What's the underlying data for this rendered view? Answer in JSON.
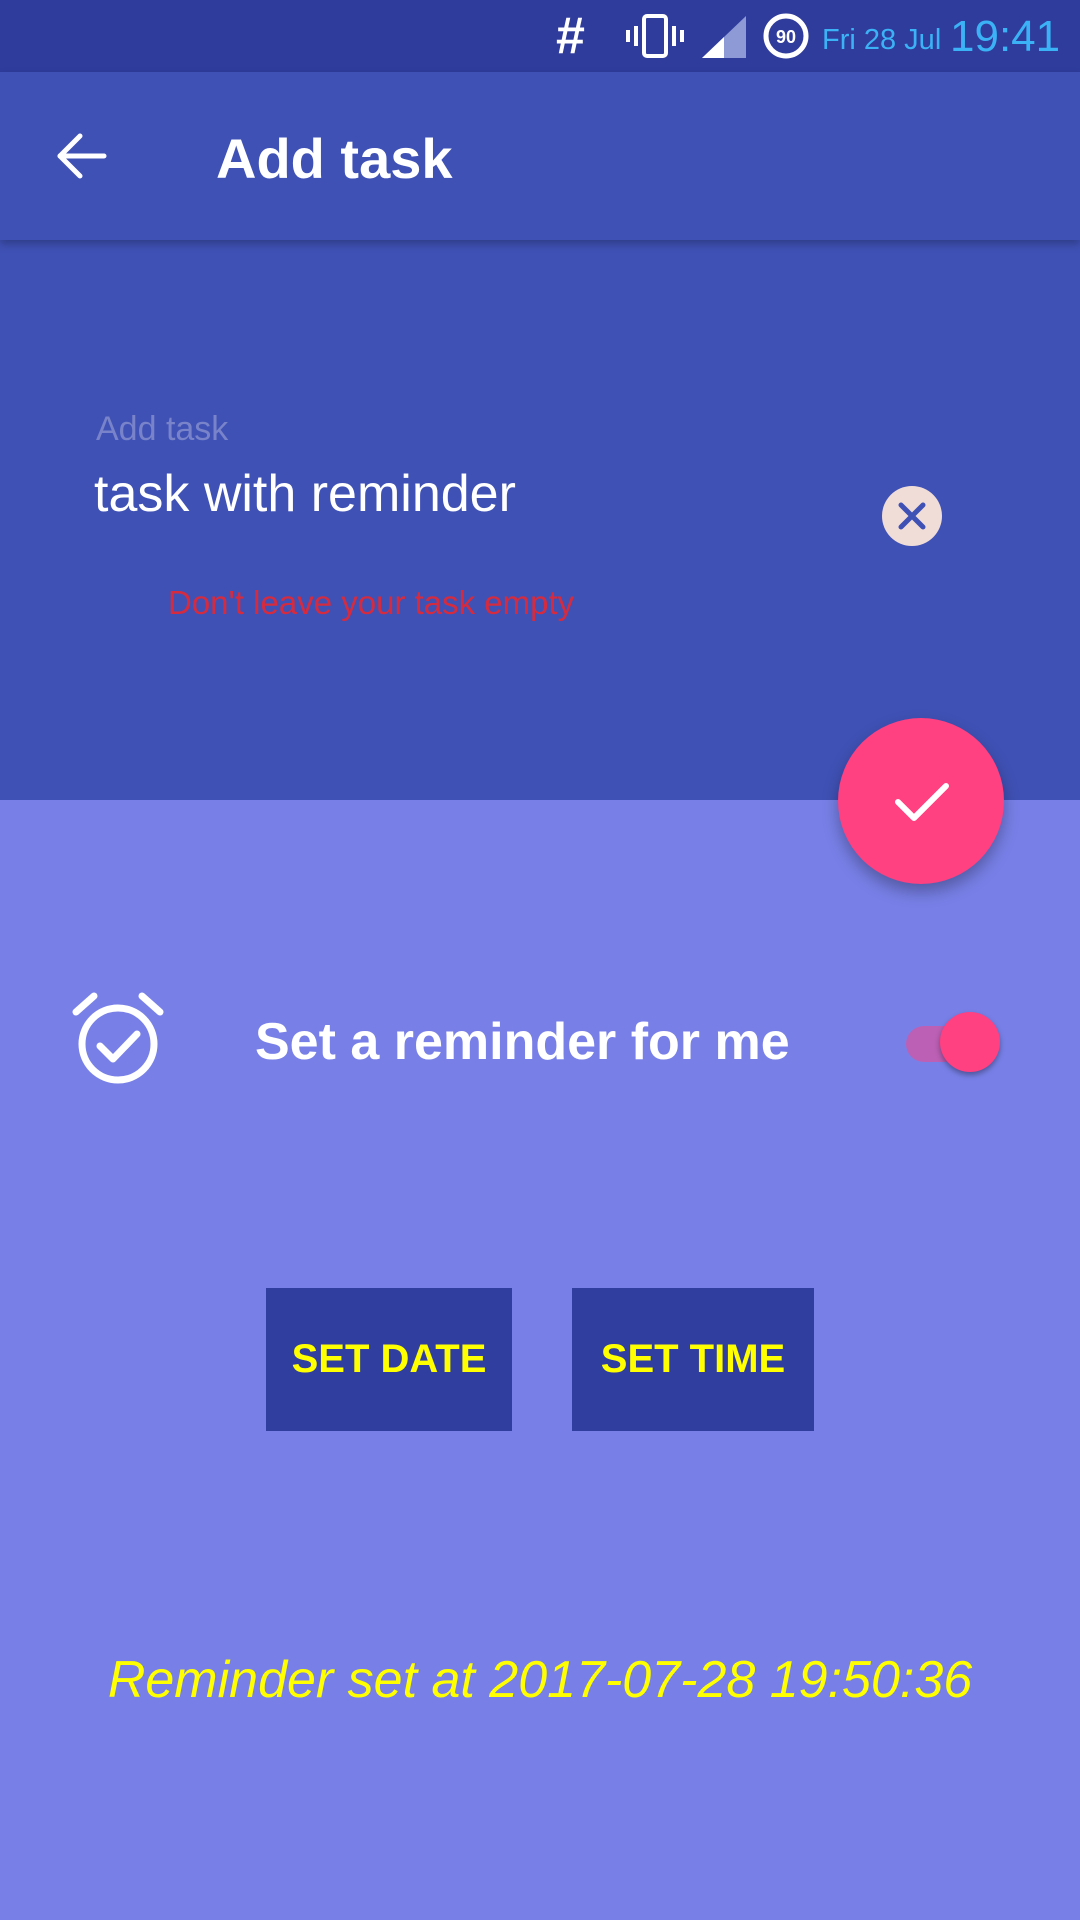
{
  "status_bar": {
    "carrier_symbol": "#",
    "battery_level": "90",
    "date": "Fri 28 Jul",
    "time": "19:41",
    "accent_color": "#3BB2F5"
  },
  "app_bar": {
    "title": "Add task",
    "back_icon": "arrow-back-icon",
    "color": "#3F51B5"
  },
  "task_form": {
    "field_label": "Add task",
    "input_value": "task with reminder",
    "clear_icon": "close-circle-icon",
    "error_text": "Don't leave your task empty",
    "error_color": "#D62B3E"
  },
  "fab": {
    "icon": "check-icon",
    "color": "#FF4081"
  },
  "reminder": {
    "icon": "alarm-check-icon",
    "label": "Set a reminder for me",
    "toggle_on": true
  },
  "buttons": {
    "set_date": "SET DATE",
    "set_time": "SET TIME"
  },
  "reminder_status": "Reminder set at 2017-07-28 19:50:36",
  "colors": {
    "lower_background": "#7880E8",
    "button_background": "#303F9F",
    "highlight_text": "#FFFF00"
  }
}
